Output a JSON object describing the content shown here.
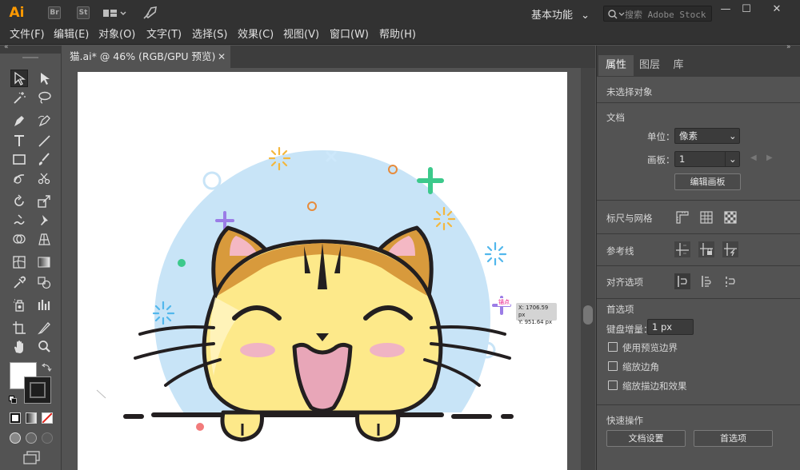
{
  "app": {
    "logo": "Ai",
    "bridge": "Br",
    "stock": "St"
  },
  "workspace": {
    "label": "基本功能",
    "search_placeholder": "搜索 Adobe Stock"
  },
  "menu": [
    "文件(F)",
    "编辑(E)",
    "对象(O)",
    "文字(T)",
    "选择(S)",
    "效果(C)",
    "视图(V)",
    "窗口(W)",
    "帮助(H)"
  ],
  "document": {
    "tab_title": "猫.ai* @ 46% (RGB/GPU 预览)"
  },
  "cursor_readout": {
    "tag": "锚点",
    "x": "X: 1706.59 px",
    "y": "Y: 951.64 px"
  },
  "panel": {
    "tabs": [
      "属性",
      "图层",
      "库"
    ],
    "no_selection": "未选择对象",
    "document_section": "文档",
    "unit_label": "单位：",
    "unit_value": "像素",
    "artboard_label": "画板：",
    "artboard_value": "1",
    "edit_artboard_button": "编辑画板",
    "rulers_grids": "标尺与网格",
    "guides": "参考线",
    "align_options": "对齐选项",
    "preferences": "首选项",
    "keyboard_increment_label": "键盘增量：",
    "keyboard_increment_value": "1 px",
    "checkboxes": [
      "使用预览边界",
      "缩放边角",
      "缩放描边和效果"
    ],
    "quick_actions": "快速操作",
    "doc_setup_button": "文档设置",
    "preferences_button": "首选项"
  },
  "colors": {
    "accent_orange": "#ff9a00",
    "cat_yellow": "#fde98a",
    "cat_brown": "#d89a3c",
    "bg_circle": "#c8e4f7",
    "cheek": "#f0b4c4",
    "mouth": "#e8a6b8",
    "outline": "#231f20"
  }
}
